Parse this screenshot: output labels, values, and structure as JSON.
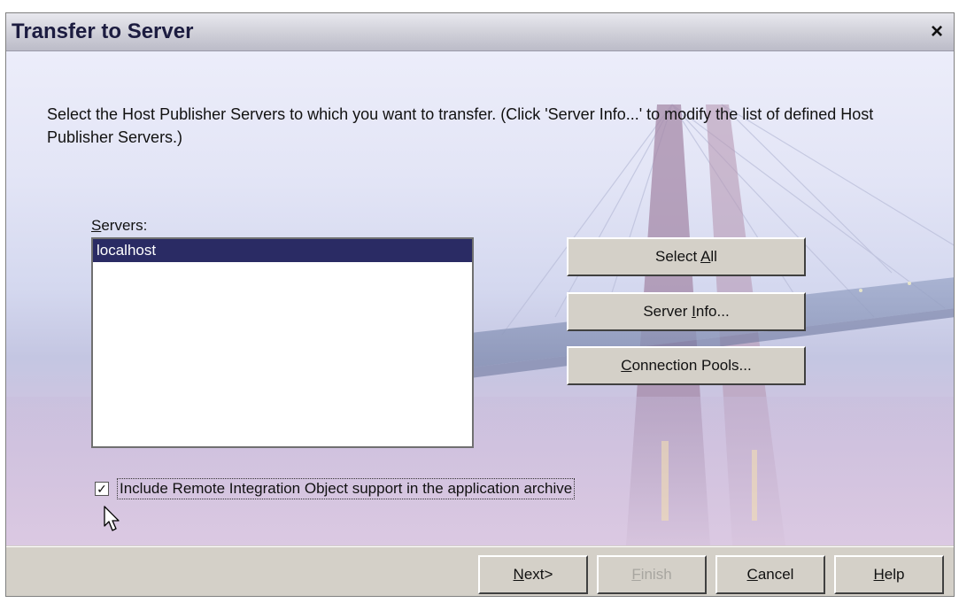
{
  "window": {
    "title": "Transfer to Server",
    "close_label": "×"
  },
  "instructions": "Select the Host Publisher Servers to which you want to transfer. (Click 'Server Info...' to modify the list of defined Host Publisher Servers.)",
  "servers": {
    "label_prefix": "S",
    "label_rest": "ervers:",
    "items": [
      "localhost"
    ],
    "selected": "localhost"
  },
  "side_buttons": {
    "select_all": {
      "pre": "Select ",
      "mnemonic": "A",
      "post": "ll"
    },
    "server_info": {
      "pre": "Server ",
      "mnemonic": "I",
      "post": "nfo..."
    },
    "connection_pools": {
      "pre": "",
      "mnemonic": "C",
      "post": "onnection Pools..."
    }
  },
  "remote_support": {
    "checked": true,
    "check_mark": "✓",
    "label": "Include Remote Integration Object support in the application archive"
  },
  "footer": {
    "next": {
      "mnemonic": "N",
      "post": "ext>"
    },
    "finish": {
      "mnemonic": "F",
      "post": "inish",
      "disabled": true
    },
    "cancel": {
      "mnemonic": "C",
      "post": "ancel"
    },
    "help": {
      "mnemonic": "H",
      "post": "elp"
    }
  },
  "colors": {
    "selection": "#2a2b64",
    "title_text": "#1c1c40"
  }
}
